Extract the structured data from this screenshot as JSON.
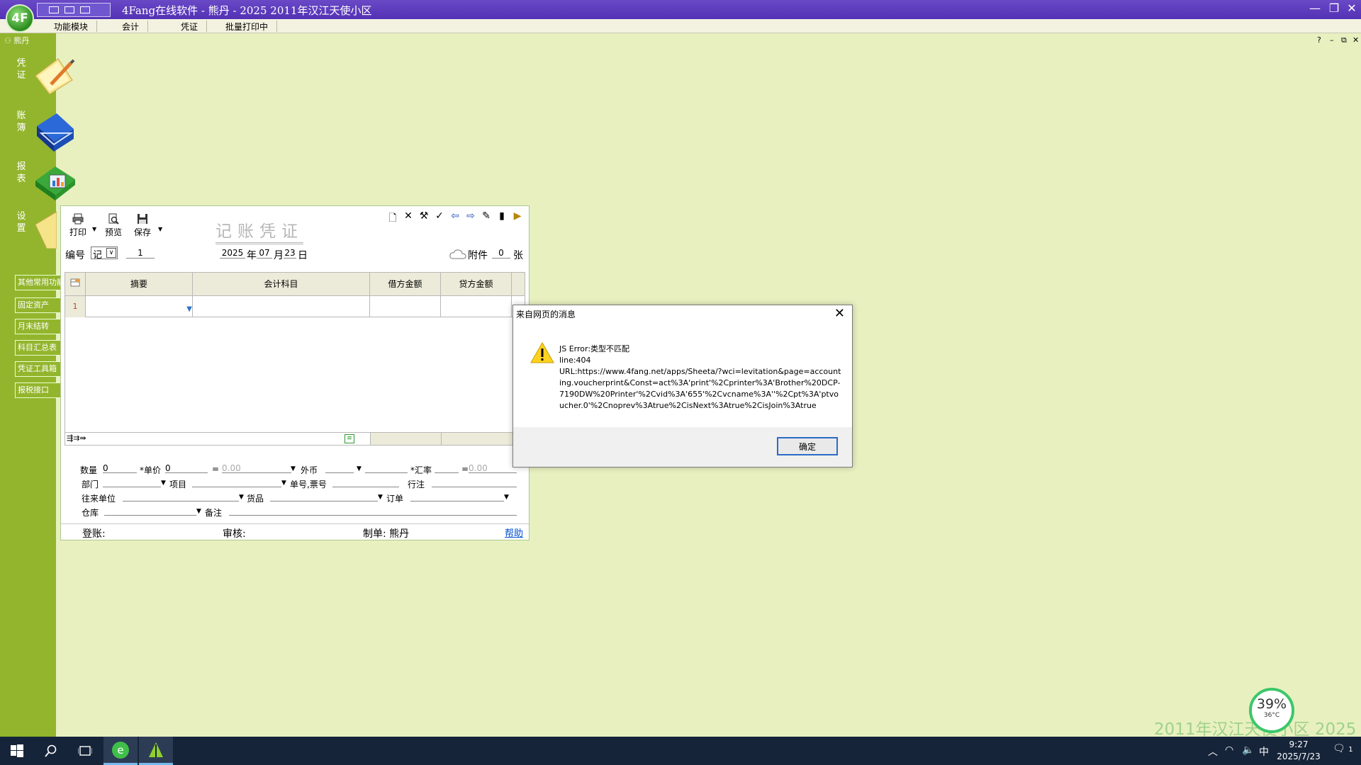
{
  "titlebar": {
    "title": "4Fang在线软件 - 熊丹 - 2025 2011年汉江天使小区",
    "logo_text": "4F",
    "minimize": "—",
    "restore": "❐",
    "close": "✕"
  },
  "menu": {
    "items": [
      "功能模块",
      "会计",
      "凭证",
      "批量打印中"
    ],
    "mdi_help": "?",
    "mdi_min": "–",
    "mdi_restore": "⧉",
    "mdi_close": "✕"
  },
  "sidebar": {
    "user_name": "熊丹",
    "big_items": [
      "凭证",
      "账簿",
      "报表",
      "设置"
    ],
    "links": [
      "其他常用功能",
      "固定资产",
      "月末结转",
      "科目汇总表",
      "凭证工具箱",
      "报税接口"
    ]
  },
  "voucher": {
    "toolbar": {
      "print": "打印",
      "preview": "预览",
      "save": "保存"
    },
    "title": "记账凭证",
    "number_label": "编号",
    "number_type": "记",
    "number_value": "1",
    "year": "2025",
    "year_label": "年",
    "month": "07",
    "month_label": "月",
    "day": "23",
    "day_label": "日",
    "attach_label": "附件",
    "attach_count": "0",
    "attach_unit": "张",
    "columns": [
      "摘要",
      "会计科目",
      "借方金额",
      "贷方金额"
    ],
    "row_index": "1",
    "form": {
      "qty_label": "数量",
      "qty_value": "0",
      "price_label": "*单价",
      "price_value": "0",
      "equals": "=",
      "amount_value": "0.00",
      "currency_label": "外币",
      "rate_label": "*汇率",
      "rate_equals": "=",
      "rate_value": "0.00",
      "dept_label": "部门",
      "project_label": "项目",
      "docno_label": "单号,票号",
      "memo_label": "行注",
      "partner_label": "往来单位",
      "goods_label": "货品",
      "order_label": "订单",
      "warehouse_label": "仓库",
      "remark_label": "备注"
    },
    "footer": {
      "posting_label": "登账:",
      "review_label": "审核:",
      "maker_label": "制单: 熊丹",
      "help": "帮助"
    }
  },
  "dialog": {
    "title": "来自网页的消息",
    "message": "JS Error:类型不匹配\nline:404\nURL:https://www.4fang.net/apps/Sheeta/?wci=levitation&page=accounting.voucherprint&Const=act%3A'print'%2Cprinter%3A'Brother%20DCP-7190DW%20Printer'%2Cvid%3A'655'%2Cvcname%3A''%2Cpt%3A'ptvoucher.0'%2Cnoprev%3Atrue%2CisNext%3Atrue%2CisJoin%3Atrue",
    "ok": "确定"
  },
  "gauge": {
    "percent": "39%",
    "temp": "36°C"
  },
  "watermark": {
    "text": "2011年汉江天使小区     2025"
  },
  "taskbar": {
    "ime": "中",
    "time": "9:27",
    "date": "2025/7/23",
    "notification_count": "1"
  }
}
